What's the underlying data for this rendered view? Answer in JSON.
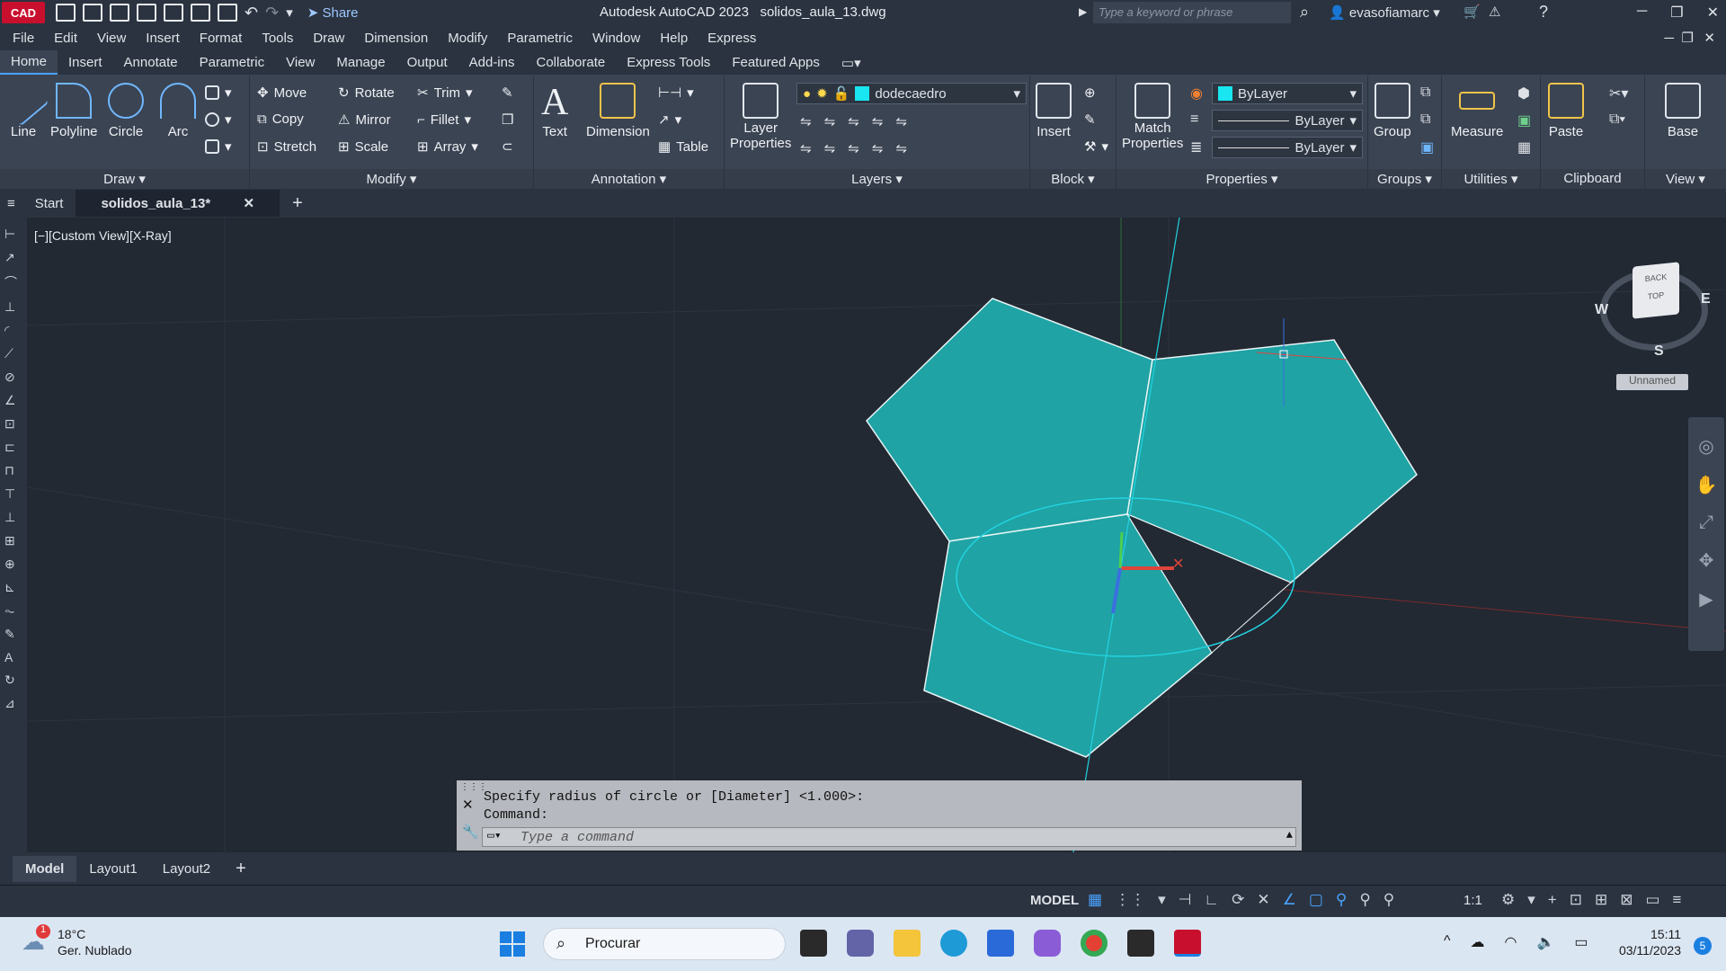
{
  "titlebar": {
    "app_badge": "CAD",
    "share_label": "Share",
    "app_title": "Autodesk AutoCAD 2023",
    "file_name": "solidos_aula_13.dwg",
    "search_placeholder": "Type a keyword or phrase",
    "user_name": "evasofiamarc"
  },
  "menu": [
    "File",
    "Edit",
    "View",
    "Insert",
    "Format",
    "Tools",
    "Draw",
    "Dimension",
    "Modify",
    "Parametric",
    "Window",
    "Help",
    "Express"
  ],
  "ribbon_tabs": [
    "Home",
    "Insert",
    "Annotate",
    "Parametric",
    "View",
    "Manage",
    "Output",
    "Add-ins",
    "Collaborate",
    "Express Tools",
    "Featured Apps"
  ],
  "ribbon": {
    "draw": {
      "title": "Draw",
      "line": "Line",
      "polyline": "Polyline",
      "circle": "Circle",
      "arc": "Arc"
    },
    "modify": {
      "title": "Modify",
      "move": "Move",
      "rotate": "Rotate",
      "trim": "Trim",
      "copy": "Copy",
      "mirror": "Mirror",
      "fillet": "Fillet",
      "stretch": "Stretch",
      "scale": "Scale",
      "array": "Array"
    },
    "annotation": {
      "title": "Annotation",
      "text": "Text",
      "dimension": "Dimension",
      "table": "Table"
    },
    "layers": {
      "title": "Layers",
      "layer_properties_1": "Layer",
      "layer_properties_2": "Properties",
      "current_layer": "dodecaedro"
    },
    "block": {
      "title": "Block",
      "insert": "Insert"
    },
    "properties": {
      "title": "Properties",
      "match_1": "Match",
      "match_2": "Properties",
      "color": "ByLayer",
      "linetype": "ByLayer",
      "lineweight": "ByLayer"
    },
    "groups": {
      "title": "Groups",
      "group": "Group"
    },
    "utilities": {
      "title": "Utilities",
      "measure": "Measure"
    },
    "clipboard": {
      "title": "Clipboard",
      "paste": "Paste"
    },
    "view": {
      "title": "View",
      "base": "Base"
    }
  },
  "doc_tabs": {
    "start": "Start",
    "active": "solidos_aula_13*"
  },
  "viewport": {
    "label": "[−][Custom View][X-Ray]",
    "viewcube": {
      "back": "BACK",
      "top": "TOP",
      "w": "W",
      "e": "E",
      "s": "S",
      "named_view": "Unnamed"
    },
    "colors": {
      "face": "#1fa3a5",
      "edge": "#e8f4f4",
      "circle": "#22d3e0"
    }
  },
  "command": {
    "line1": "Specify radius of circle or [Diameter] <1.000>:",
    "line2": "Command:",
    "placeholder": "Type a command"
  },
  "layout_tabs": [
    "Model",
    "Layout1",
    "Layout2"
  ],
  "status": {
    "model": "MODEL",
    "scale": "1:1"
  },
  "taskbar": {
    "temperature": "18°C",
    "weather": "Ger. Nublado",
    "weather_badge": "1",
    "search_label": "Procurar",
    "time": "15:11",
    "date": "03/11/2023",
    "notif_count": "5"
  }
}
